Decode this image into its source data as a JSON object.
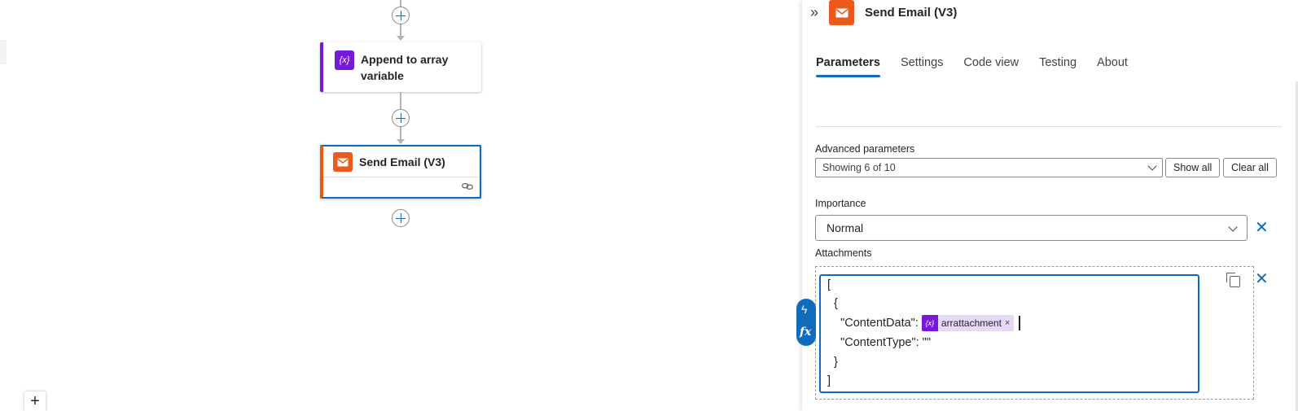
{
  "canvas": {
    "nodes": [
      {
        "title": "Append to array variable",
        "icon": "variable-icon",
        "icon_text": "{x}",
        "accent": "#7719d9"
      },
      {
        "title": "Send Email (V3)",
        "icon": "email-icon",
        "accent": "#eb5a1a",
        "footer_icon": "link-icon"
      }
    ],
    "zoom_label": "+"
  },
  "panel": {
    "collapse_label": "»",
    "title": "Send Email (V3)",
    "tabs": [
      "Parameters",
      "Settings",
      "Code view",
      "Testing",
      "About"
    ],
    "active_tab": "Parameters",
    "advanced": {
      "label": "Advanced parameters",
      "value": "Showing 6 of 10",
      "show_all": "Show all",
      "clear_all": "Clear all"
    },
    "importance": {
      "label": "Importance",
      "value": "Normal",
      "clear": "✕"
    },
    "attachments": {
      "label": "Attachments",
      "clear": "✕",
      "lines": {
        "l1": "[",
        "l2": "  {",
        "l3_prefix": "    \"ContentData\": ",
        "token_icon": "{x}",
        "token": "arrattachment",
        "token_remove": "×",
        "l4": "    \"ContentType\": \"\"",
        "l5": "  }",
        "l6": "]"
      },
      "dynamic_icon": "ϟ",
      "fx_label": "fx"
    }
  },
  "colors": {
    "accent": "#0f6cbd",
    "email": "#eb5a1a",
    "variable": "#7719d9"
  }
}
